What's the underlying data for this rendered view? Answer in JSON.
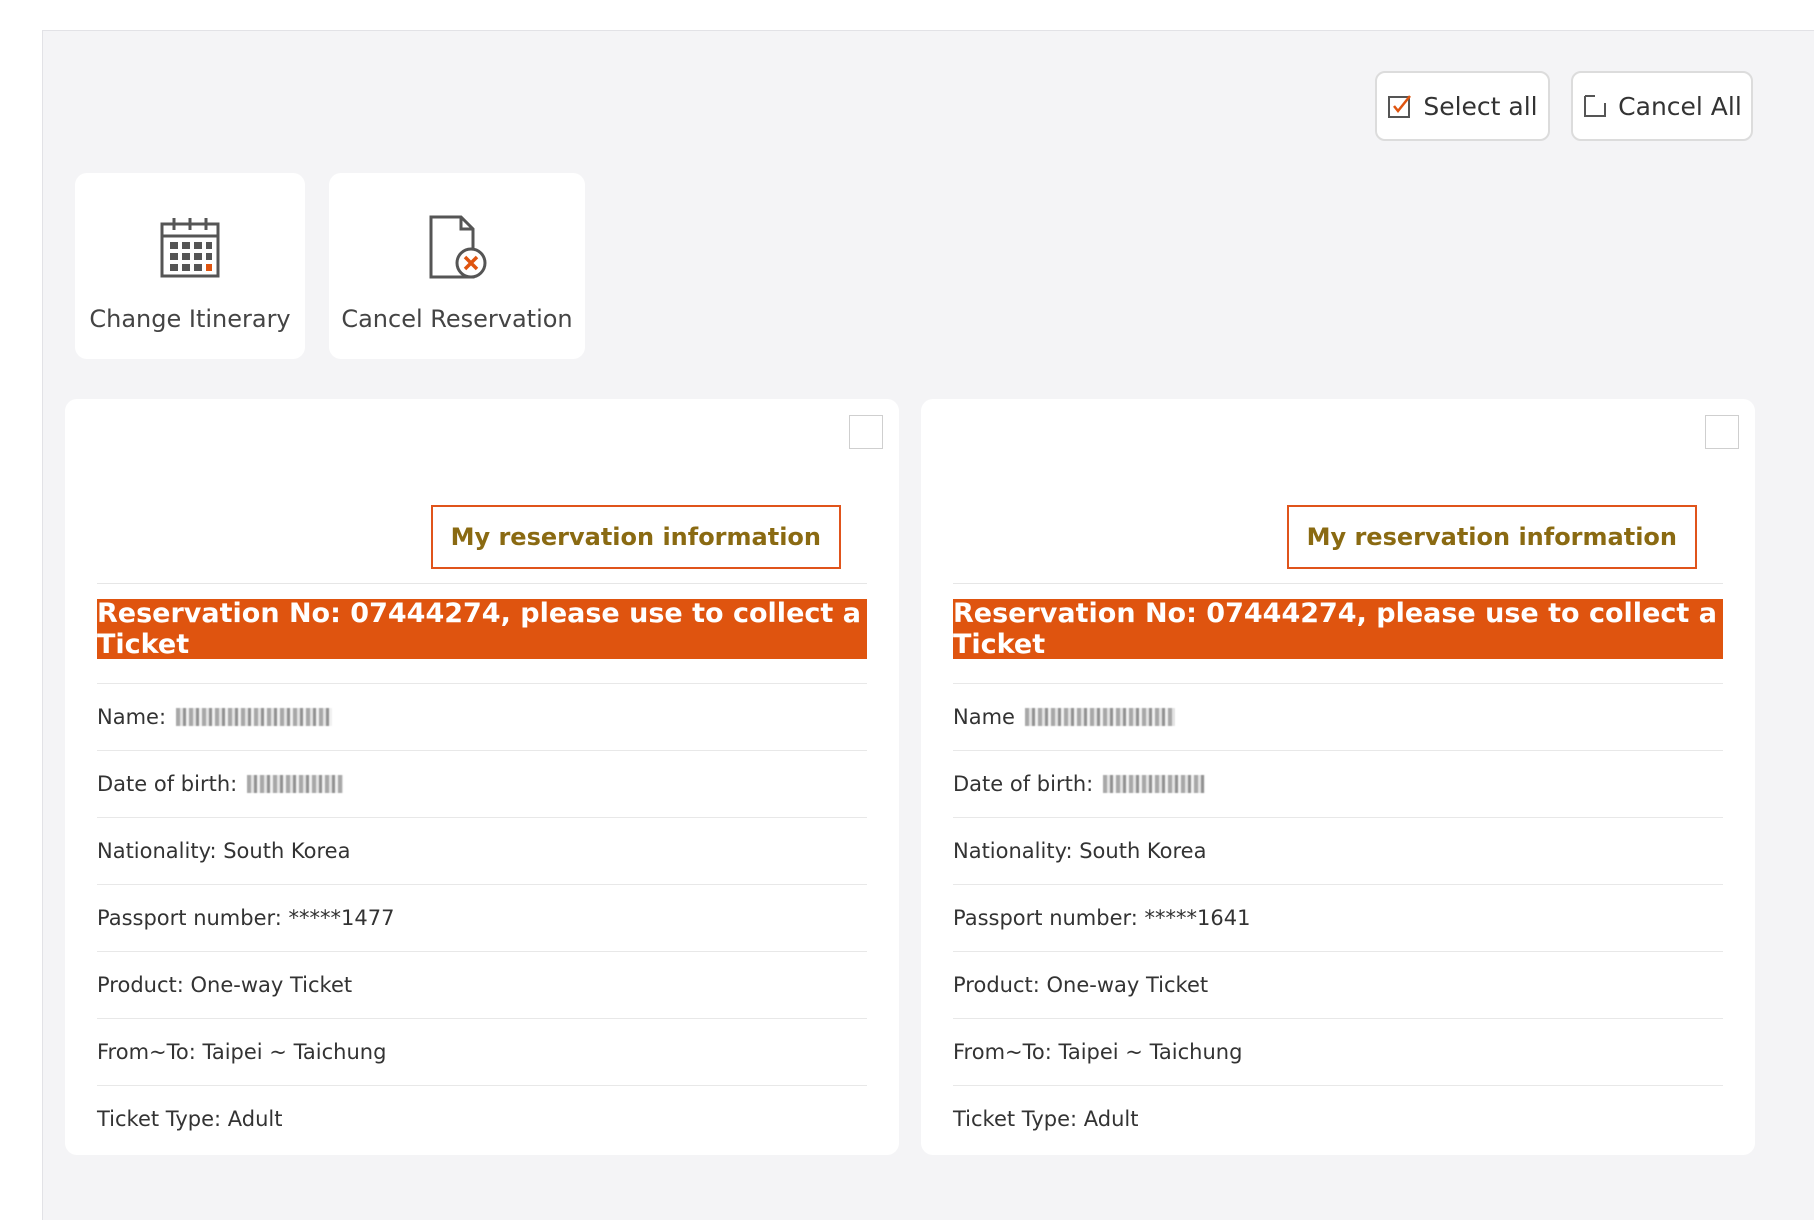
{
  "toolbar": {
    "select_all_label": "Select all",
    "cancel_all_label": "Cancel All"
  },
  "actions": {
    "change_itinerary": "Change Itinerary",
    "cancel_reservation": "Cancel Reservation"
  },
  "colors": {
    "accent": "#df540f",
    "info_button_text": "#8a6a12",
    "panel_background": "#f4f4f6"
  },
  "cards": [
    {
      "info_button": "My reservation information",
      "banner": "Reservation No: 07444274, please use to collect a Ticket",
      "name_label": "Name:",
      "dob_label": "Date of birth:",
      "nationality": "Nationality: South Korea",
      "passport": "Passport number: *****1477",
      "product": "Product: One-way Ticket",
      "route": "From~To: Taipei ~ Taichung",
      "ticket_type": "Ticket Type: Adult"
    },
    {
      "info_button": "My reservation information",
      "banner": "Reservation No: 07444274, please use to collect a Ticket",
      "name_label": "Name",
      "dob_label": "Date of birth:",
      "nationality": "Nationality: South Korea",
      "passport": "Passport number: *****1641",
      "product": "Product: One-way Ticket",
      "route": "From~To: Taipei ~ Taichung",
      "ticket_type": "Ticket Type: Adult"
    }
  ]
}
